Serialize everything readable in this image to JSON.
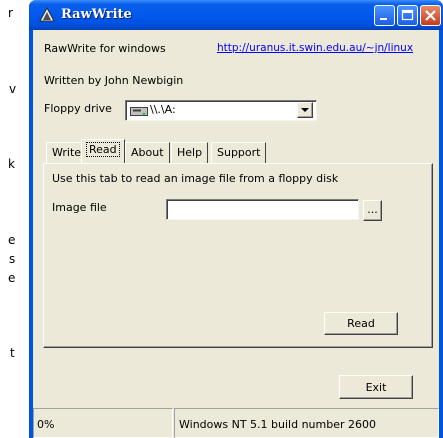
{
  "background_fragments": [
    "r",
    "v",
    "k",
    "e",
    "s",
    "e",
    "t"
  ],
  "window": {
    "title": "RawWrite",
    "colors": {
      "titlebar": "#0054e3",
      "face": "#ece9d8"
    }
  },
  "header": {
    "app_label": "RawWrite for windows",
    "url": "http://uranus.it.swin.edu.au/~jn/linux",
    "author": "Written by John Newbigin",
    "floppy_label": "Floppy drive",
    "floppy_value": "\\\\.\\A:"
  },
  "tabs": [
    {
      "label": "Write"
    },
    {
      "label": "Read"
    },
    {
      "label": "About"
    },
    {
      "label": "Help"
    },
    {
      "label": "Support"
    }
  ],
  "read_tab": {
    "description": "Use this tab to read an image file from a floppy disk",
    "image_file_label": "Image file",
    "image_file_value": "",
    "browse_label": "...",
    "read_button": "Read"
  },
  "exit_button": "Exit",
  "status": {
    "progress": "0%",
    "message": "Windows NT 5.1 build number 2600"
  }
}
